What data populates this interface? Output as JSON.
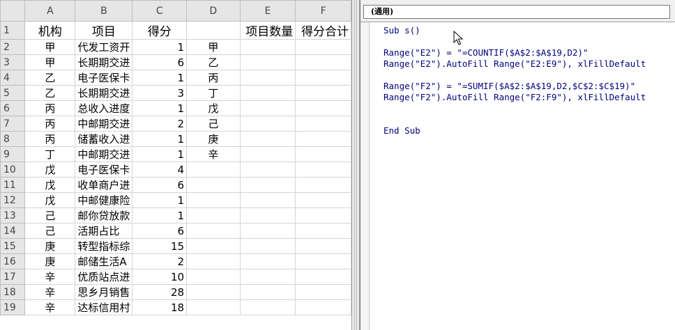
{
  "sheet": {
    "column_headers": [
      "A",
      "B",
      "C",
      "D",
      "E",
      "F"
    ],
    "rows": [
      {
        "num": "1",
        "a": "机构",
        "b": "项目",
        "c": "得分",
        "d": "",
        "e": "项目数量",
        "f": "得分合计"
      },
      {
        "num": "2",
        "a": "甲",
        "b": "代发工资开",
        "c": "1",
        "d": "甲",
        "e": "",
        "f": ""
      },
      {
        "num": "3",
        "a": "甲",
        "b": "长期期交进",
        "c": "6",
        "d": "乙",
        "e": "",
        "f": ""
      },
      {
        "num": "4",
        "a": "乙",
        "b": "电子医保卡",
        "c": "1",
        "d": "丙",
        "e": "",
        "f": ""
      },
      {
        "num": "5",
        "a": "乙",
        "b": "长期期交进",
        "c": "3",
        "d": "丁",
        "e": "",
        "f": ""
      },
      {
        "num": "6",
        "a": "丙",
        "b": "总收入进度",
        "c": "1",
        "d": "戊",
        "e": "",
        "f": ""
      },
      {
        "num": "7",
        "a": "丙",
        "b": "中邮期交进",
        "c": "2",
        "d": "己",
        "e": "",
        "f": ""
      },
      {
        "num": "8",
        "a": "丙",
        "b": "储蓄收入进",
        "c": "1",
        "d": "庚",
        "e": "",
        "f": ""
      },
      {
        "num": "9",
        "a": "丁",
        "b": "中邮期交进",
        "c": "1",
        "d": "辛",
        "e": "",
        "f": ""
      },
      {
        "num": "10",
        "a": "戊",
        "b": "电子医保卡",
        "c": "4",
        "d": "",
        "e": "",
        "f": ""
      },
      {
        "num": "11",
        "a": "戊",
        "b": "收单商户进",
        "c": "6",
        "d": "",
        "e": "",
        "f": ""
      },
      {
        "num": "12",
        "a": "戊",
        "b": "中邮健康险",
        "c": "1",
        "d": "",
        "e": "",
        "f": ""
      },
      {
        "num": "13",
        "a": "己",
        "b": "邮你贷放款",
        "c": "1",
        "d": "",
        "e": "",
        "f": ""
      },
      {
        "num": "14",
        "a": "己",
        "b": "活期占比",
        "c": "6",
        "d": "",
        "e": "",
        "f": ""
      },
      {
        "num": "15",
        "a": "庚",
        "b": "转型指标综",
        "c": "15",
        "d": "",
        "e": "",
        "f": ""
      },
      {
        "num": "16",
        "a": "庚",
        "b": "邮储生活A",
        "c": "2",
        "d": "",
        "e": "",
        "f": ""
      },
      {
        "num": "17",
        "a": "辛",
        "b": "优质站点进",
        "c": "10",
        "d": "",
        "e": "",
        "f": ""
      },
      {
        "num": "18",
        "a": "辛",
        "b": "思乡月销售",
        "c": "28",
        "d": "",
        "e": "",
        "f": ""
      },
      {
        "num": "19",
        "a": "辛",
        "b": "达标信用村",
        "c": "18",
        "d": "",
        "e": "",
        "f": ""
      }
    ]
  },
  "vba": {
    "object_dropdown": "(通用)",
    "code_lines": [
      "Sub s()",
      "",
      "Range(\"E2\") = \"=COUNTIF($A$2:$A$19,D2)\"",
      "Range(\"E2\").AutoFill Range(\"E2:E9\"), xlFillDefault",
      "",
      "Range(\"F2\") = \"=SUMIF($A$2:$A$19,D2,$C$2:$C$19)\"",
      "Range(\"F2\").AutoFill Range(\"F2:F9\"), xlFillDefault",
      "",
      "",
      "End Sub"
    ]
  },
  "icons": {
    "cursor": "mouse-pointer-icon"
  }
}
